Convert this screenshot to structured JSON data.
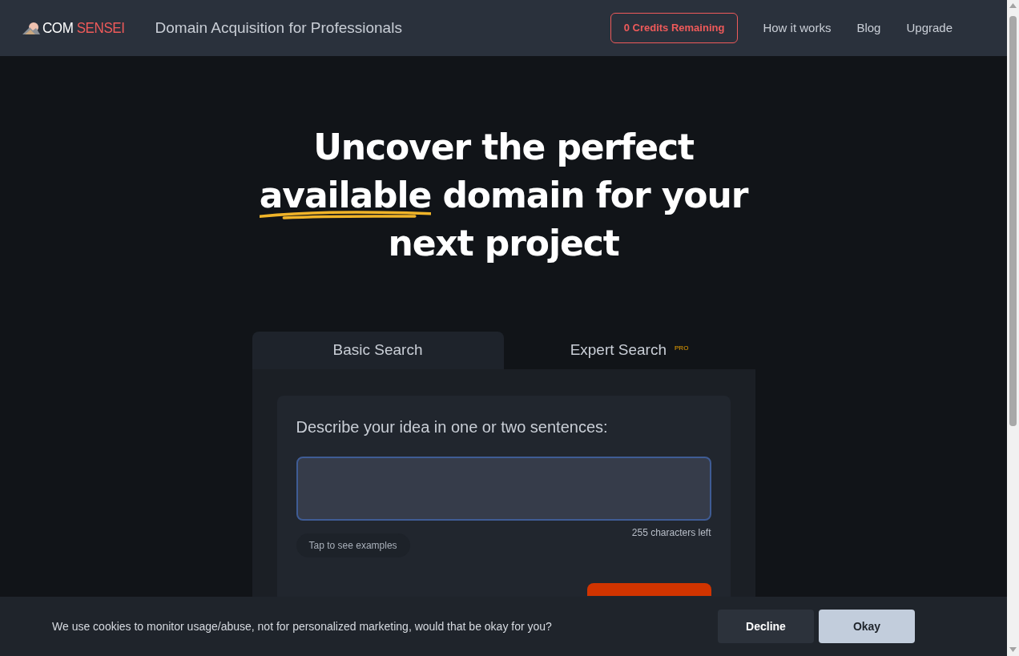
{
  "header": {
    "logo": {
      "prefix": "COM",
      "suffix": "SENSEI"
    },
    "tagline": "Domain Acquisition for Professionals",
    "credits": "0 Credits Remaining",
    "nav": [
      "How it works",
      "Blog",
      "Upgrade"
    ]
  },
  "headline": [
    [
      {
        "text": "Uncover the perfect",
        "underlined": false
      }
    ],
    [
      {
        "text": "available",
        "underlined": true
      },
      {
        "text": " domain for your",
        "underlined": false
      }
    ],
    [
      {
        "text": "next project",
        "underlined": false
      }
    ]
  ],
  "tabs": [
    {
      "label": "Basic Search",
      "selected": true
    },
    {
      "label": "Expert Search",
      "selected": false,
      "badge": "PRO"
    }
  ],
  "form": {
    "prompt": "Describe your idea in one or two sentences:",
    "counter": "255 characters left",
    "examples": "Tap to see examples"
  },
  "cookie_bar": {
    "message": "We use cookies to monitor usage/abuse, not for personalized marketing, would that be okay for you?",
    "buttons": [
      {
        "label": "Decline",
        "kind": "secondary"
      },
      {
        "label": "Okay",
        "kind": "primary"
      }
    ]
  }
}
